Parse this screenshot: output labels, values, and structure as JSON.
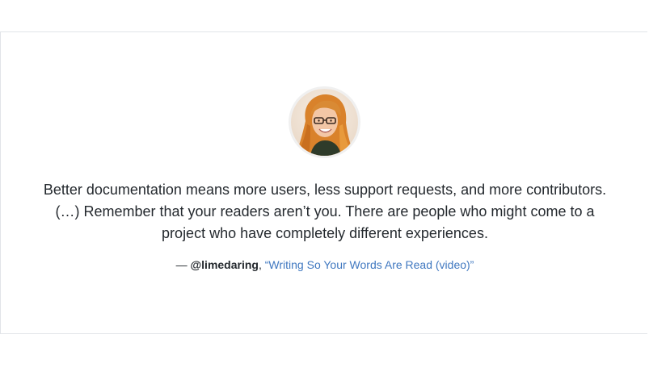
{
  "testimonial": {
    "avatar_icon": "person-photo-avatar",
    "quote": "Better documentation means more users, less support requests, and more contributors. (…) Remember that your readers aren’t you. There are people who might come to a project who have completely different experiences.",
    "attribution": {
      "dash": "— ",
      "handle": "@limedaring",
      "separator": ", ",
      "link_text": "“Writing So Your Words Are Read (video)”"
    }
  },
  "colors": {
    "text": "#24292e",
    "link": "#4078c0",
    "border": "#e1e4e8"
  }
}
